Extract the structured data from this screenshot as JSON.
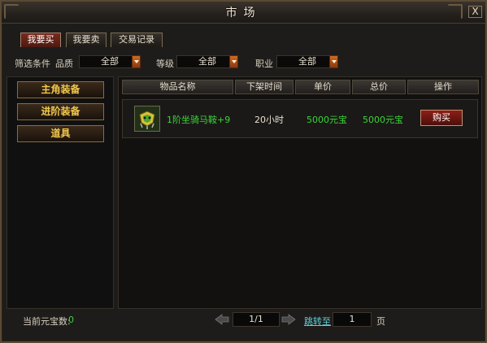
{
  "window": {
    "title": "市场",
    "close_label": "X"
  },
  "tabs": [
    {
      "label": "我要买"
    },
    {
      "label": "我要卖"
    },
    {
      "label": "交易记录"
    }
  ],
  "filters": {
    "label": "筛选条件",
    "quality": {
      "label": "品质",
      "value": "全部"
    },
    "level": {
      "label": "等级",
      "value": "全部"
    },
    "profession": {
      "label": "职业",
      "value": "全部"
    }
  },
  "categories": [
    {
      "label": "主角装备"
    },
    {
      "label": "进阶装备"
    },
    {
      "label": "道具"
    }
  ],
  "table": {
    "headers": [
      "物品名称",
      "下架时间",
      "单价",
      "总价",
      "操作"
    ],
    "rows": [
      {
        "name": "1阶坐骑马鞍+9",
        "time": "20小时",
        "unit_price": "5000元宝",
        "total_price": "5000元宝",
        "action": "购买"
      }
    ]
  },
  "footer": {
    "balance_label": "当前元宝数:",
    "balance_value": "0",
    "page": "1/1",
    "jump_label": "跳转至",
    "jump_value": "1",
    "page_suffix": "页"
  },
  "colors": {
    "item_green": "#39d639",
    "gold": "#f2c94c",
    "accent_red": "#7a2a1c"
  },
  "icons": {
    "item": "saddle-icon",
    "prev": "prev-arrow-icon",
    "next": "next-arrow-icon"
  }
}
